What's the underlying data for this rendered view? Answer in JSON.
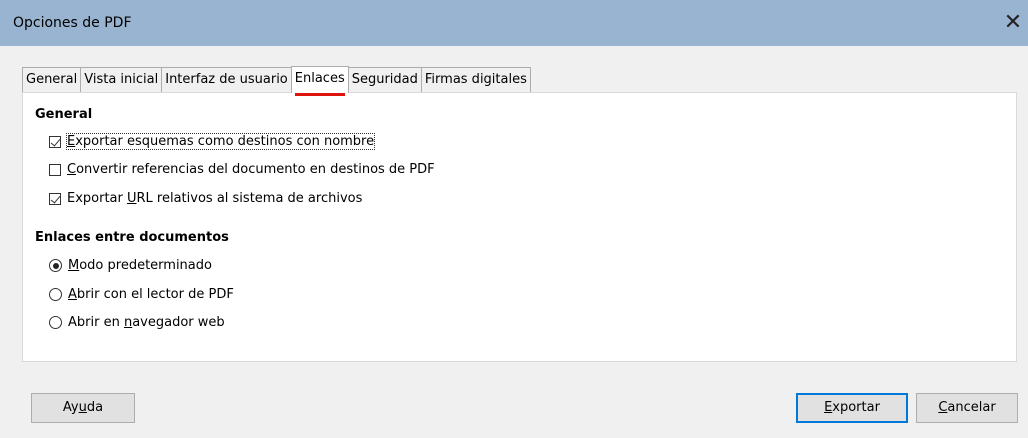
{
  "window": {
    "title": "Opciones de PDF",
    "close_glyph": "✕"
  },
  "tabs": [
    {
      "label": "General",
      "active": false
    },
    {
      "label": "Vista inicial",
      "active": false
    },
    {
      "label": "Interfaz de usuario",
      "active": false
    },
    {
      "label": "Enlaces",
      "active": true
    },
    {
      "label": "Seguridad",
      "active": false
    },
    {
      "label": "Firmas digitales",
      "active": false
    }
  ],
  "general_section": {
    "title": "General",
    "options": [
      {
        "label": "Exportar esquemas como destinos con nombre",
        "checked": true
      },
      {
        "label": "Convertir referencias del documento en destinos de PDF",
        "checked": false
      },
      {
        "label": "Exportar URL relativos al sistema de archivos",
        "checked": true
      }
    ]
  },
  "links_section": {
    "title": "Enlaces entre documentos",
    "options": [
      {
        "label": "Modo predeterminado",
        "selected": true
      },
      {
        "label": "Abrir con el lector de PDF",
        "selected": false
      },
      {
        "label": "Abrir en navegador web",
        "selected": false
      }
    ]
  },
  "buttons": {
    "help": "Ayuda",
    "export": "Exportar",
    "cancel": "Cancelar"
  },
  "colors": {
    "titlebar": "#99b4d1",
    "active_tab_underline": "#e0140e",
    "default_button_border": "#0078d7"
  }
}
